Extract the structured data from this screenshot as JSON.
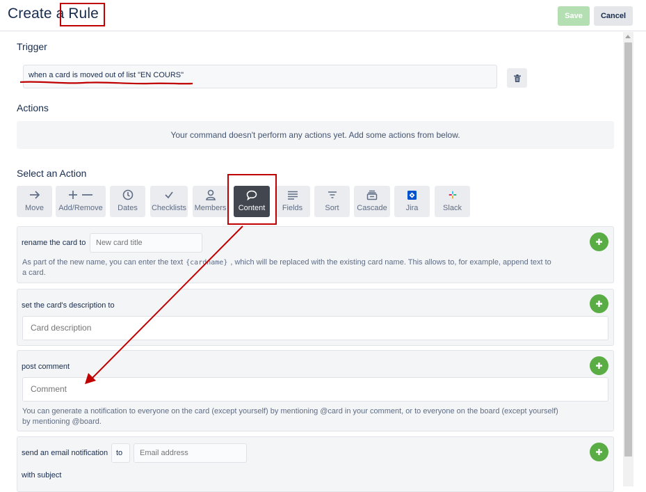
{
  "header": {
    "title_prefix": "Create a ",
    "title_word": "Rule",
    "save_label": "Save",
    "cancel_label": "Cancel"
  },
  "trigger": {
    "heading": "Trigger",
    "value": "when a card is moved out of list \"EN COURS\""
  },
  "actions": {
    "heading": "Actions",
    "empty_message": "Your command doesn't perform any actions yet. Add some actions from below."
  },
  "select_action": {
    "heading": "Select an Action",
    "selected": "Content",
    "tabs": [
      {
        "label": "Move",
        "icon": "arrow-right-icon"
      },
      {
        "label": "Add/Remove",
        "icon": "plus-minus-icon"
      },
      {
        "label": "Dates",
        "icon": "clock-icon"
      },
      {
        "label": "Checklists",
        "icon": "check-icon"
      },
      {
        "label": "Members",
        "icon": "person-icon"
      },
      {
        "label": "Content",
        "icon": "speech-bubble-icon"
      },
      {
        "label": "Fields",
        "icon": "lines-icon"
      },
      {
        "label": "Sort",
        "icon": "filter-icon"
      },
      {
        "label": "Cascade",
        "icon": "stack-icon"
      },
      {
        "label": "Jira",
        "icon": "jira-icon"
      },
      {
        "label": "Slack",
        "icon": "slack-icon"
      }
    ]
  },
  "cards": {
    "rename": {
      "label": "rename the card to",
      "placeholder": "New card title",
      "help_before": "As part of the new name, you can enter the text",
      "token": "{cardname}",
      "help_after": ", which will be replaced with the existing card name. This allows to, for example, append text to",
      "help_line2": "a card."
    },
    "description": {
      "label": "set the card's description to",
      "placeholder": "Card description"
    },
    "comment": {
      "label": "post comment",
      "placeholder": "Comment",
      "help_line1": "You can generate a notification to everyone on the card (except yourself) by mentioning @card in your comment, or to everyone on the board (except yourself)",
      "help_line2": "by mentioning @board."
    },
    "email": {
      "label": "send an email notification",
      "to_value": "to",
      "placeholder": "Email address",
      "subject_label": "with subject"
    }
  },
  "colors": {
    "annotation": "#c00000",
    "add_button": "#5aac44",
    "active_tab": "#42474f",
    "save_disabled": "#b3dfb3"
  }
}
